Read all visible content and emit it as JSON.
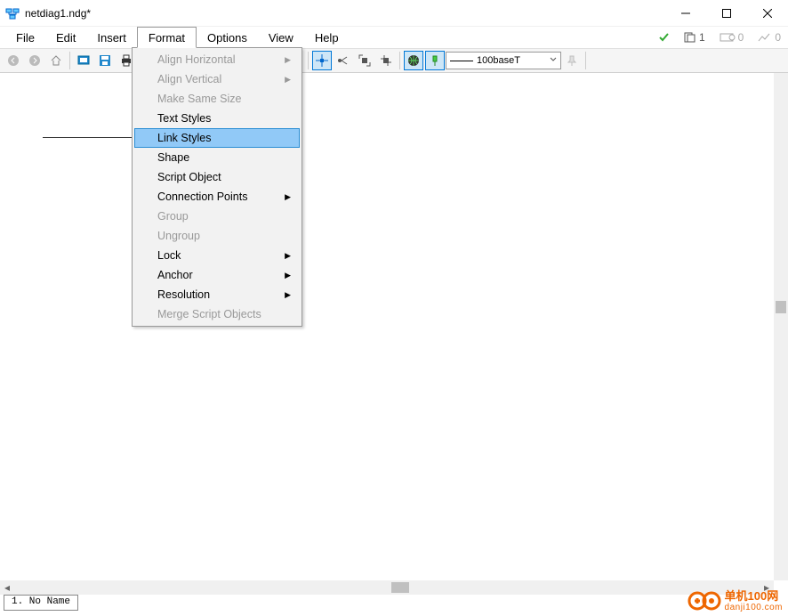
{
  "window": {
    "title": "netdiag1.ndg*"
  },
  "menubar": {
    "items": [
      "File",
      "Edit",
      "Insert",
      "Format",
      "Options",
      "View",
      "Help"
    ],
    "active_index": 3,
    "indicators": {
      "check": "✓",
      "pages": "1",
      "layers": "0",
      "graph": "0"
    }
  },
  "toolbar": {
    "combo": {
      "label": "100baseT"
    }
  },
  "dropdown": {
    "items": [
      {
        "label": "Align Horizontal",
        "disabled": true,
        "submenu": true
      },
      {
        "label": "Align Vertical",
        "disabled": true,
        "submenu": true
      },
      {
        "label": "Make Same Size",
        "disabled": true
      },
      {
        "label": "Text Styles"
      },
      {
        "label": "Link Styles",
        "highlight": true
      },
      {
        "label": "Shape"
      },
      {
        "label": "Script Object"
      },
      {
        "label": "Connection Points",
        "submenu": true
      },
      {
        "label": "Group",
        "disabled": true
      },
      {
        "label": "Ungroup",
        "disabled": true
      },
      {
        "label": "Lock",
        "submenu": true
      },
      {
        "label": "Anchor",
        "submenu": true
      },
      {
        "label": "Resolution",
        "submenu": true
      },
      {
        "label": "Merge Script Objects",
        "disabled": true
      }
    ]
  },
  "tabs": {
    "items": [
      "1. No Name"
    ]
  },
  "watermark": {
    "line1": "单机100网",
    "line2": "danji100.com"
  }
}
